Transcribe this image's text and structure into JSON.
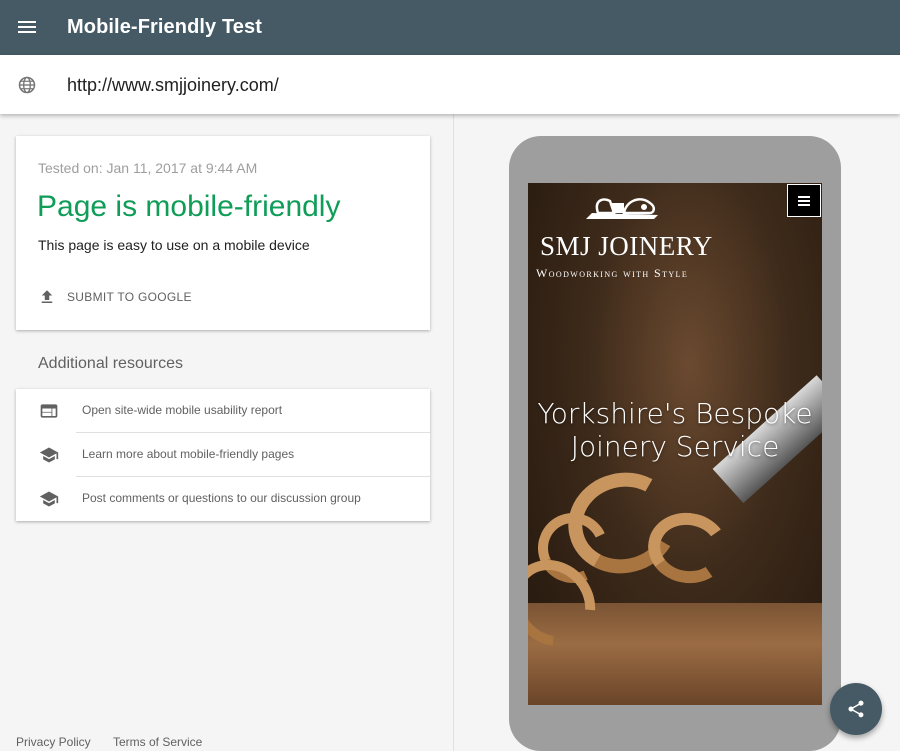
{
  "header": {
    "title": "Mobile-Friendly Test"
  },
  "url_bar": {
    "value": "http://www.smjjoinery.com/"
  },
  "result": {
    "tested_on": "Tested on: Jan 11, 2017 at 9:44 AM",
    "verdict": "Page is mobile-friendly",
    "subtitle": "This page is easy to use on a mobile device",
    "submit_label": "SUBMIT TO GOOGLE"
  },
  "resources": {
    "title": "Additional resources",
    "items": [
      {
        "label": "Open site-wide mobile usability report",
        "icon": "web-report-icon"
      },
      {
        "label": "Learn more about mobile-friendly pages",
        "icon": "school-icon"
      },
      {
        "label": "Post comments or questions to our discussion group",
        "icon": "school-icon"
      }
    ]
  },
  "footer": {
    "privacy": "Privacy Policy",
    "terms": "Terms of Service"
  },
  "preview": {
    "brand": "SMJ JOINERY",
    "tagline": "Woodworking with Style",
    "hero": "Yorkshire's Bespoke Joinery Service"
  },
  "colors": {
    "header_bg": "#455a64",
    "verdict_green": "#0f9d58",
    "phone_frame": "#9e9e9e"
  }
}
